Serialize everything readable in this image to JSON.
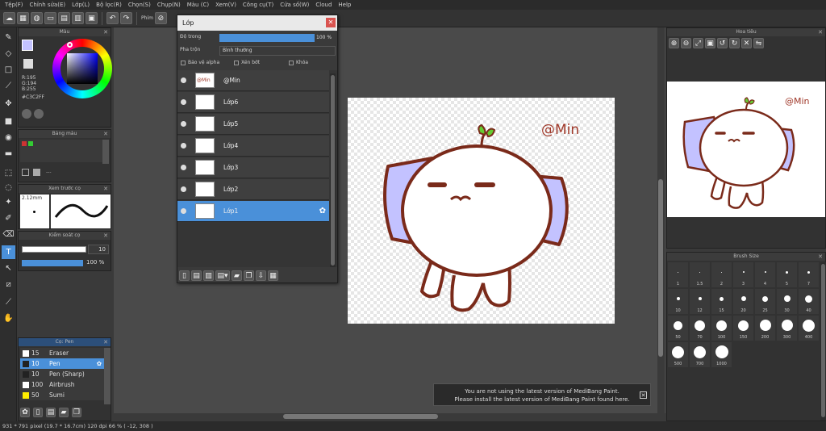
{
  "menu": [
    "Tệp(F)",
    "Chỉnh sửa(E)",
    "Lớp(L)",
    "Bộ lọc(R)",
    "Chọn(S)",
    "Chụp(N)",
    "Màu (C)",
    "Xem(V)",
    "Công cụ(T)",
    "Cửa số(W)",
    "Cloud",
    "Help"
  ],
  "toolbar": {
    "label": "Phím"
  },
  "color_panel": {
    "title": "Màu",
    "r": "R:195",
    "g": "G:194",
    "b": "B:255",
    "hex": "#C3C2FF",
    "fg": "#C3C2FF"
  },
  "palette_panel": {
    "title": "Bảng màu",
    "dash": "---"
  },
  "preview_panel": {
    "title": "Xem trước cọ",
    "size": "2.12mm"
  },
  "brush_control": {
    "title": "Kiểm soát cọ",
    "size": "10",
    "opacity": "100 %"
  },
  "brush_list": {
    "title": "Cọ: Pen",
    "items": [
      {
        "num": "15",
        "name": "Eraser",
        "color": "#ffffff",
        "sel": false
      },
      {
        "num": "10",
        "name": "Pen",
        "color": "#222222",
        "sel": true
      },
      {
        "num": "10",
        "name": "Pen (Sharp)",
        "color": "#222222",
        "sel": false
      },
      {
        "num": "100",
        "name": "Airbrush",
        "color": "#ffffff",
        "sel": false
      },
      {
        "num": "50",
        "name": "Sumi",
        "color": "#ffee00",
        "sel": false
      }
    ]
  },
  "layer_window": {
    "title": "Lớp",
    "opacity_label": "Độ trong",
    "opacity_value": "100 %",
    "blend_label": "Pha trộn",
    "blend_value": "Bình thường",
    "protect_alpha": "Bảo vệ alpha",
    "clipping": "Xén bớt",
    "lock": "Khóa",
    "layers": [
      {
        "name": "@Min",
        "thumb": "@Min",
        "sel": false
      },
      {
        "name": "Lớp6",
        "thumb": "",
        "sel": false
      },
      {
        "name": "Lớp5",
        "thumb": "",
        "sel": false
      },
      {
        "name": "Lớp4",
        "thumb": "",
        "sel": false
      },
      {
        "name": "Lớp3",
        "thumb": "",
        "sel": false
      },
      {
        "name": "Lớp2",
        "thumb": "",
        "sel": false
      },
      {
        "name": "Lớp1",
        "thumb": "",
        "sel": true
      }
    ]
  },
  "canvas": {
    "signature": "@Min"
  },
  "navigator": {
    "title": "Hoa tiêu",
    "signature": "@Min"
  },
  "brush_size": {
    "title": "Brush Size",
    "sizes": [
      "1",
      "1.5",
      "2",
      "3",
      "4",
      "5",
      "7",
      "10",
      "12",
      "15",
      "20",
      "25",
      "30",
      "40",
      "50",
      "70",
      "100",
      "150",
      "200",
      "300",
      "400",
      "500",
      "700",
      "1000"
    ]
  },
  "notice": {
    "line1": "You are not using the latest version of MediBang Paint.",
    "line2": "Please install the latest version of MediBang Paint found here."
  },
  "status": {
    "text": "931 * 791 pixel   (19.7 * 16.7cm)   120 dpi   66 %   ( -12, 308 )"
  }
}
